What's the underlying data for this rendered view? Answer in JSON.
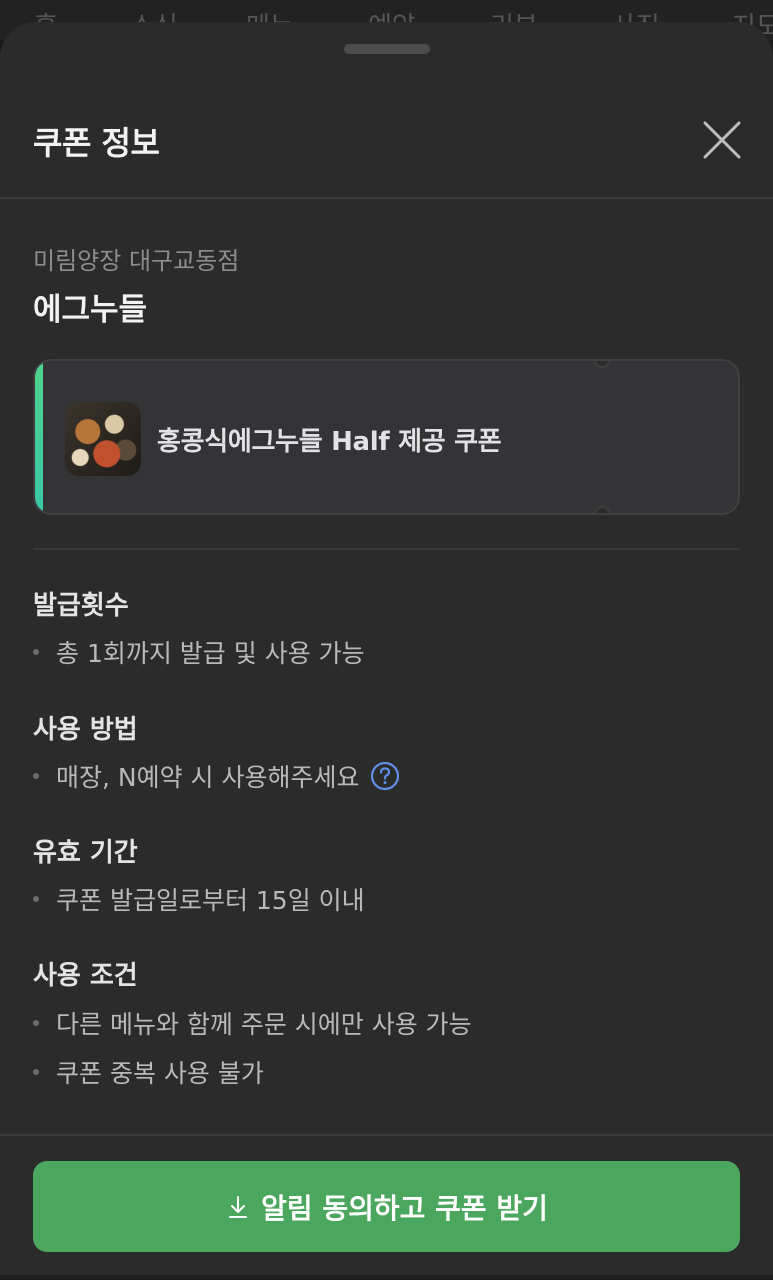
{
  "background_tabs": [
    "홈",
    "소식",
    "메뉴",
    "예약",
    "리뷰",
    "사진",
    "지도"
  ],
  "sheet": {
    "title": "쿠폰 정보",
    "close_icon": "close-icon"
  },
  "store": {
    "branch": "미림양장 대구교동점",
    "name": "에그누들"
  },
  "coupon": {
    "label": "홍콩식에그누들 Half 제공 쿠폰",
    "accent_color": "#4fd28a"
  },
  "sections": {
    "issue_count": {
      "title": "발급횟수",
      "items": [
        "총 1회까지 발급 및 사용 가능"
      ]
    },
    "usage_method": {
      "title": "사용 방법",
      "items": [
        "매장, N예약 시 사용해주세요"
      ]
    },
    "validity": {
      "title": "유효 기간",
      "items": [
        "쿠폰 발급일로부터 15일 이내"
      ]
    },
    "conditions": {
      "title": "사용 조건",
      "items": [
        "다른 메뉴와 함께 주문 시에만 사용 가능",
        "쿠폰 중복 사용 불가"
      ]
    }
  },
  "cta": {
    "label": "알림 동의하고 쿠폰 받기",
    "icon": "download-icon",
    "color": "#4ba75e"
  }
}
